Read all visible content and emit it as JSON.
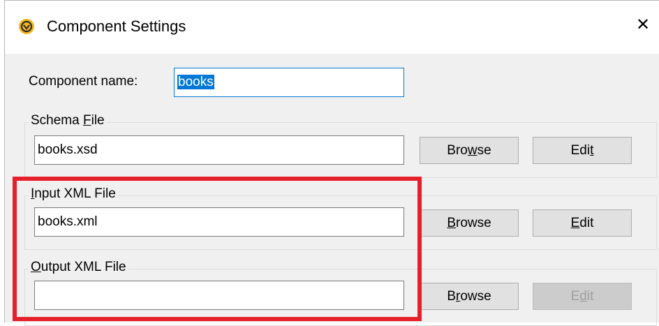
{
  "window": {
    "title": "Component Settings",
    "close_glyph": "✕",
    "icon": "mapforce-logo-icon"
  },
  "component_name": {
    "label_pre": "Component name:",
    "value": "books"
  },
  "schema_file": {
    "legend_pre": "Schema ",
    "legend_u": "F",
    "legend_post": "ile",
    "value": "books.xsd",
    "browse": {
      "pre": "Bro",
      "u": "w",
      "post": "se"
    },
    "edit": {
      "pre": "Edi",
      "u": "t",
      "post": ""
    }
  },
  "input_xml_file": {
    "legend_pre": "",
    "legend_u": "I",
    "legend_post": "nput XML File",
    "value": "books.xml",
    "browse": {
      "pre": "",
      "u": "B",
      "post": "rowse"
    },
    "edit": {
      "pre": "",
      "u": "E",
      "post": "dit"
    }
  },
  "output_xml_file": {
    "legend_pre": "",
    "legend_u": "O",
    "legend_post": "utput XML File",
    "value": "",
    "browse": {
      "pre": "B",
      "u": "r",
      "post": "owse"
    },
    "edit": {
      "pre": "E",
      "u": "d",
      "post": "it",
      "disabled": true
    }
  },
  "colors": {
    "highlight": "#e5202a",
    "selection": "#0078d7",
    "app_icon": "#f3b71a"
  }
}
